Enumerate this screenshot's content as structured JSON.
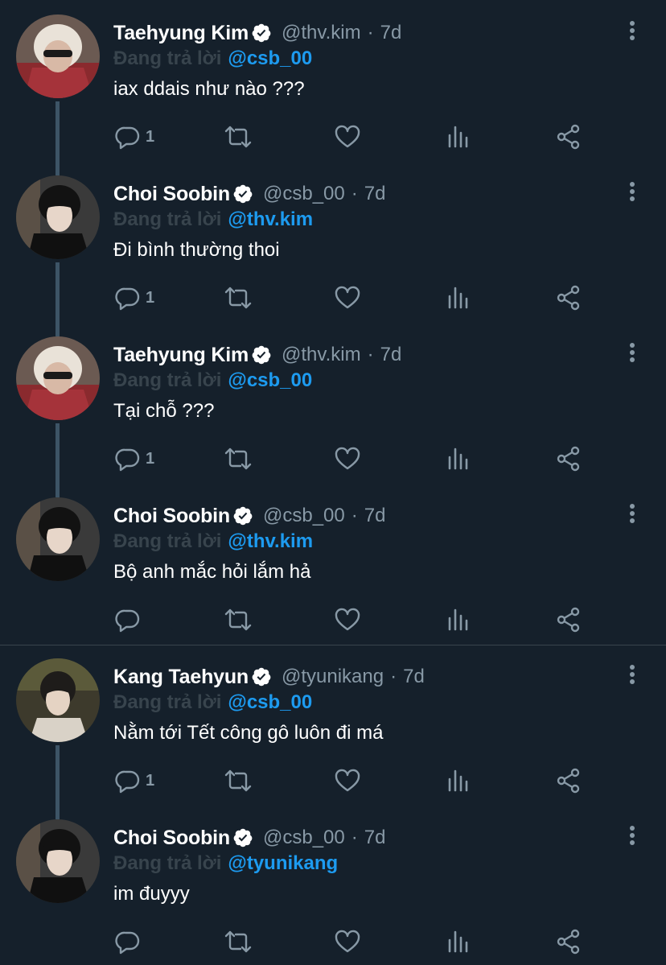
{
  "colors": {
    "background": "#15202b",
    "muted": "#8899a6",
    "replying_label": "#38444d",
    "mention": "#1d9bf0",
    "thread_line": "#3d5466",
    "verified_badge": "#ffffff"
  },
  "tweets": [
    {
      "name": "Taehyung Kim",
      "handle": "@thv.kim",
      "dot": "·",
      "time": "7d",
      "replying_label": "Đang trả lời",
      "replying_to": "@csb_00",
      "text": "iax ddais như nào ???",
      "reply_count": "1"
    },
    {
      "name": "Choi Soobin",
      "handle": "@csb_00",
      "dot": "·",
      "time": "7d",
      "replying_label": "Đang trả lời",
      "replying_to": "@thv.kim",
      "text": "Đi bình thường thoi",
      "reply_count": "1"
    },
    {
      "name": "Taehyung Kim",
      "handle": "@thv.kim",
      "dot": "·",
      "time": "7d",
      "replying_label": "Đang trả lời",
      "replying_to": "@csb_00",
      "text": "Tại chỗ ???",
      "reply_count": "1"
    },
    {
      "name": "Choi Soobin",
      "handle": "@csb_00",
      "dot": "·",
      "time": "7d",
      "replying_label": "Đang trả lời",
      "replying_to": "@thv.kim",
      "text": "Bộ anh mắc hỏi lắm hả",
      "reply_count": ""
    },
    {
      "name": "Kang Taehyun",
      "handle": "@tyunikang",
      "dot": "·",
      "time": "7d",
      "replying_label": "Đang trả lời",
      "replying_to": "@csb_00",
      "text": "Nằm tới Tết công gô luôn đi má",
      "reply_count": "1"
    },
    {
      "name": "Choi Soobin",
      "handle": "@csb_00",
      "dot": "·",
      "time": "7d",
      "replying_label": "Đang trả lời",
      "replying_to": "@tyunikang",
      "text": "im đuyyy",
      "reply_count": ""
    }
  ]
}
